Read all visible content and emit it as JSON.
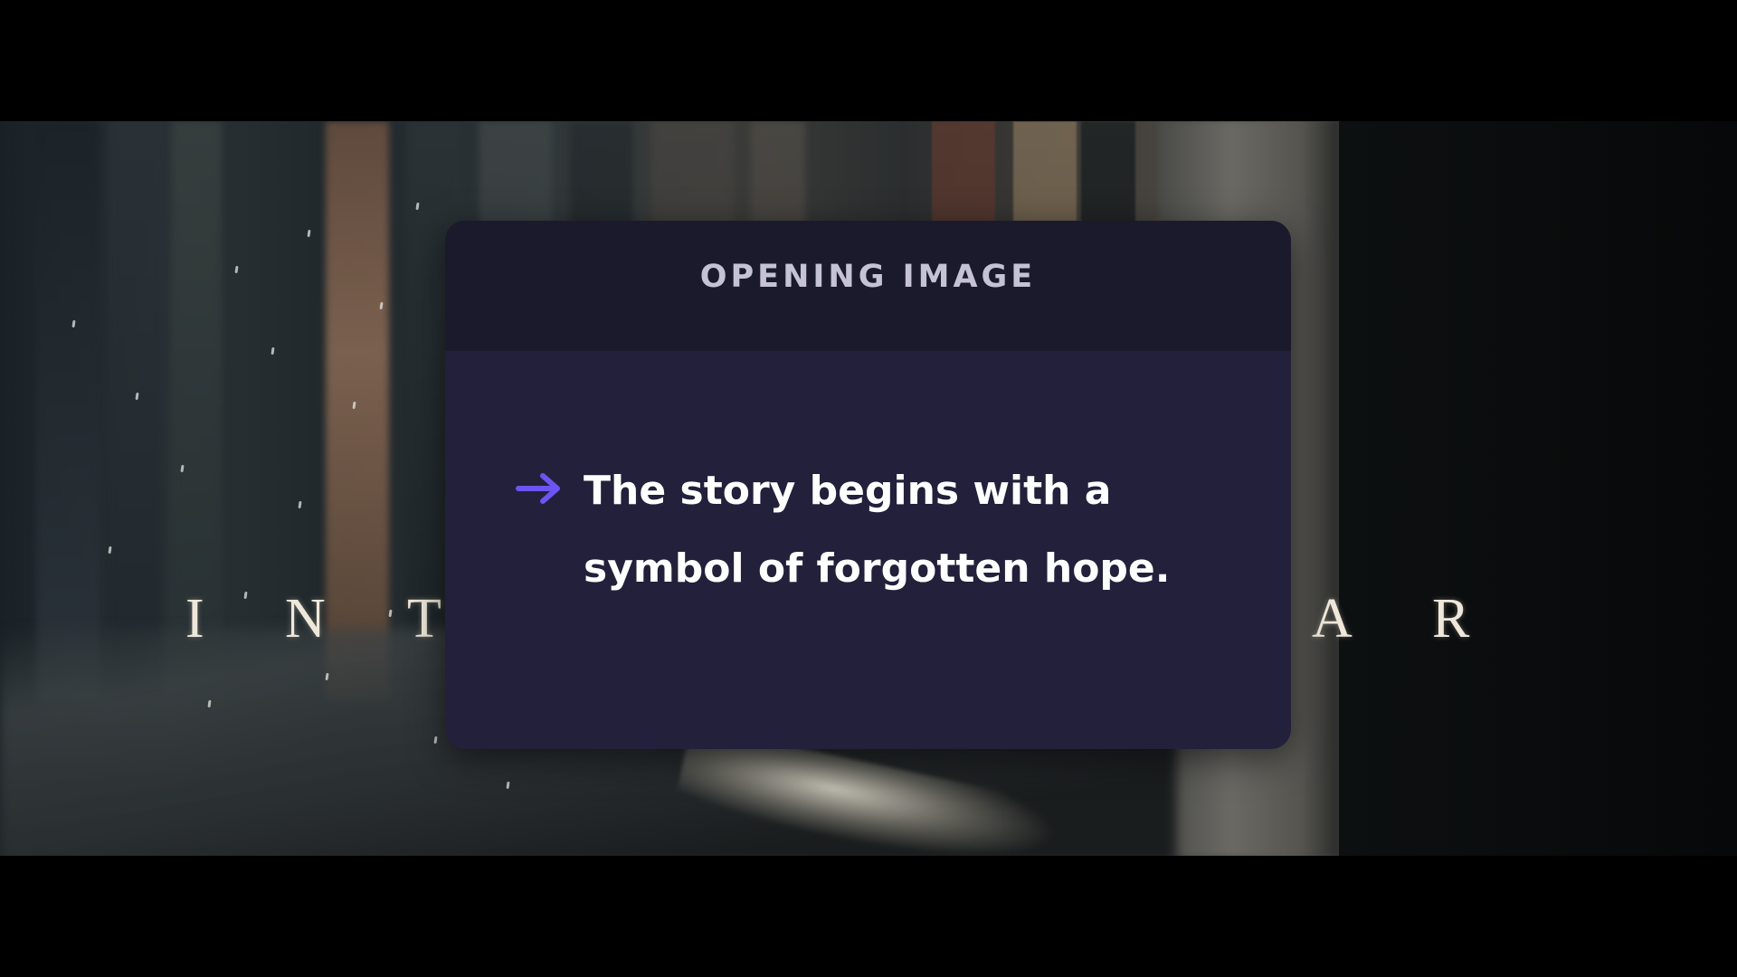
{
  "scene": {
    "title_letters_left": [
      "I",
      "N",
      "T"
    ],
    "title_letters_right": [
      "A",
      "R"
    ]
  },
  "card": {
    "title": "OPENING IMAGE",
    "arrow_icon": "right-arrow-icon",
    "body_line_1": "The story begins with a",
    "body_line_2": "symbol of forgotten hope."
  },
  "colors": {
    "accent": "#6a55f0",
    "card_body": "#22203a",
    "card_header": "#1b1a2c",
    "title_text": "#c6c2d6"
  }
}
